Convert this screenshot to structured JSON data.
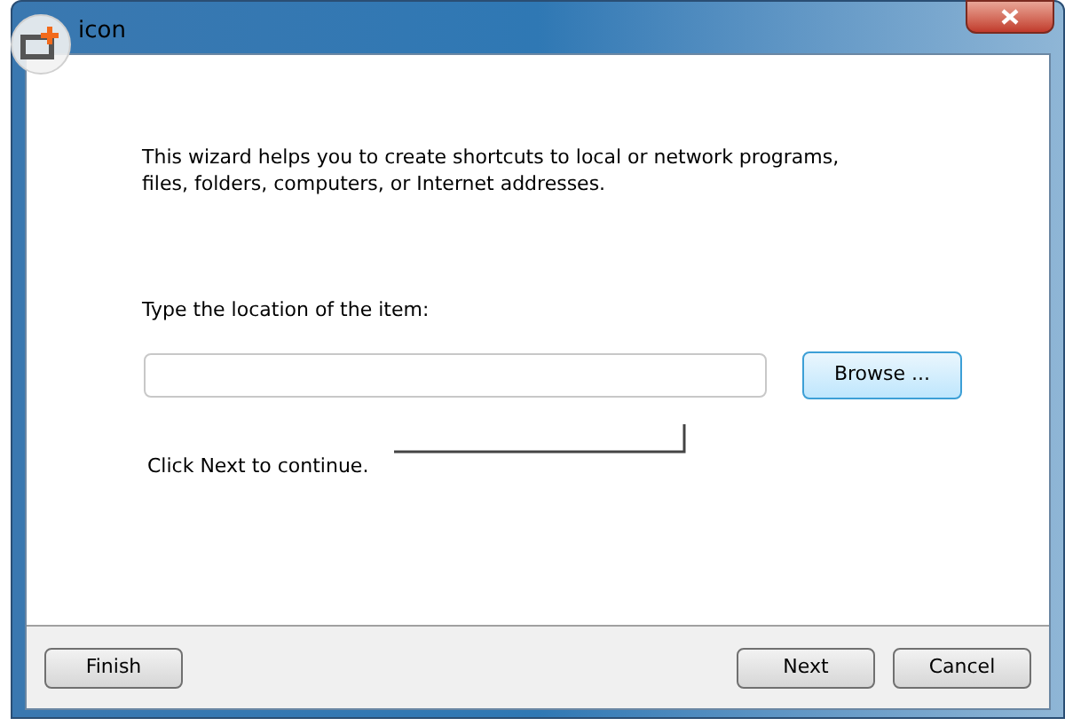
{
  "window": {
    "title": "icon"
  },
  "intro": "This wizard helps you to create shortcuts to local or network programs, files, folders, computers, or Internet addresses.",
  "location": {
    "label": "Type the location of the item:",
    "browse_button": "Browse ..."
  },
  "hint": "Click Next to continue.",
  "buttons": [
    {
      "label": "Finish",
      "kind": "left"
    },
    {
      "label": "Next",
      "kind": "right"
    },
    {
      "label": "Cancel",
      "kind": "right"
    }
  ]
}
